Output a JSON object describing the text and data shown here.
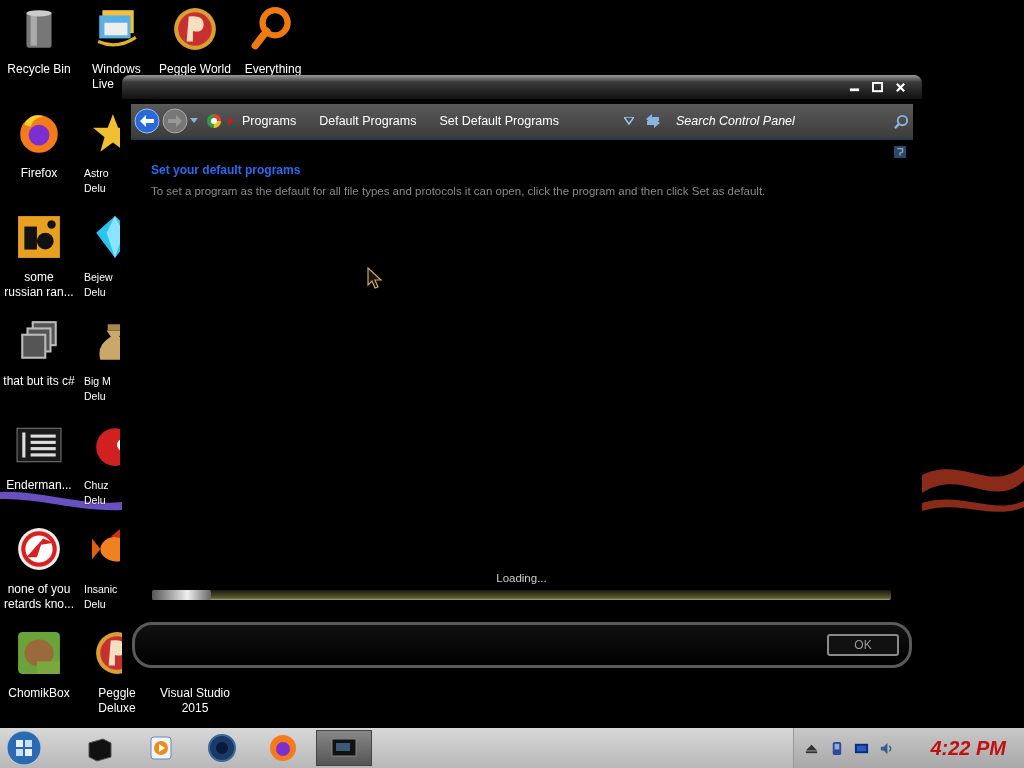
{
  "desktop_icons": [
    {
      "label": "Recycle Bin"
    },
    {
      "label": "Firefox"
    },
    {
      "label": "some\nrussian ran..."
    },
    {
      "label": "that but its c#"
    },
    {
      "label": "Enderman..."
    },
    {
      "label": "none of you\nretards kno..."
    },
    {
      "label": "ChomikBox"
    },
    {
      "label": "Windows\nLive"
    },
    {
      "label": "Astro\nDelu"
    },
    {
      "label": "Bejew\nDelu"
    },
    {
      "label": "Big M\nDelu"
    },
    {
      "label": "Chuz\nDelu"
    },
    {
      "label": "Insanic\nDelu"
    },
    {
      "label": "Peggle\nDeluxe"
    },
    {
      "label": "Peggle World"
    },
    {
      "label": "Visual Studio\n2015"
    },
    {
      "label": "Everything"
    }
  ],
  "window": {
    "breadcrumb": [
      "Programs",
      "Default Programs",
      "Set Default Programs"
    ],
    "search": {
      "placeholder": "Search Control Panel"
    },
    "heading": "Set your default programs",
    "description": "To set a program as the default for all file types and protocols it can open, click the program and then click Set as default.",
    "loading": {
      "text": "Loading...",
      "level": 0.08
    },
    "buttons": [
      {
        "label": "OK"
      }
    ]
  },
  "taskbar": {
    "items": [
      {
        "selected": false
      },
      {
        "selected": false
      },
      {
        "selected": false
      },
      {
        "selected": false
      },
      {
        "selected": true
      }
    ],
    "clock": "4:22 PM"
  }
}
